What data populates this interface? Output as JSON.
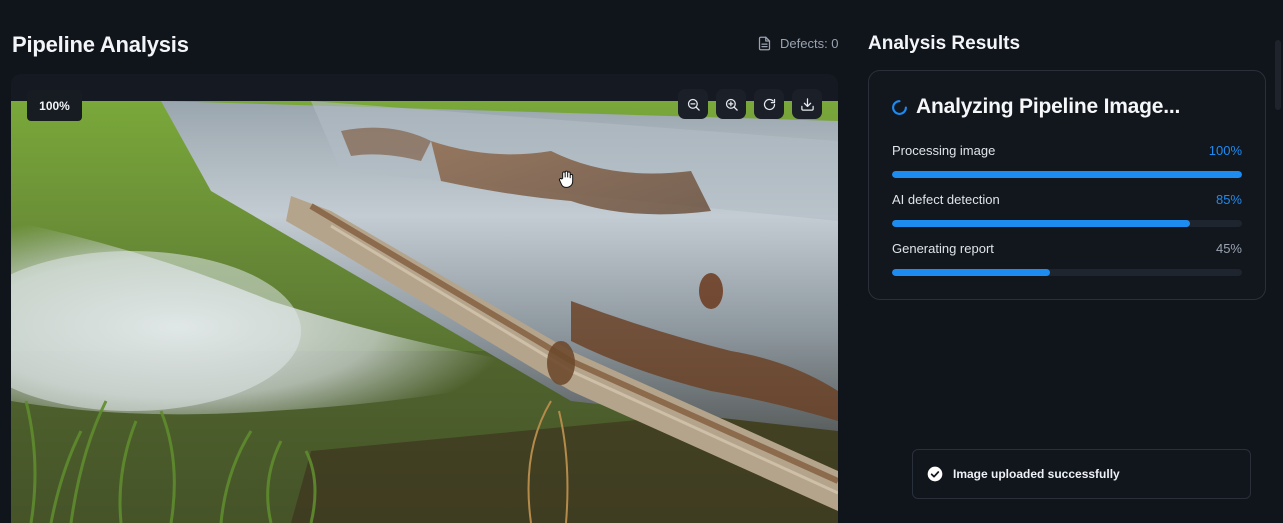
{
  "page": {
    "title": "Pipeline Analysis",
    "defects_label": "Defects: 0"
  },
  "viewer": {
    "zoom": "100%",
    "tools": [
      {
        "icon": "zoom-out-icon"
      },
      {
        "icon": "zoom-in-icon"
      },
      {
        "icon": "rotate-icon"
      },
      {
        "icon": "download-icon"
      }
    ]
  },
  "results": {
    "title": "Analysis Results",
    "heading": "Analyzing Pipeline Image...",
    "steps": [
      {
        "label": "Processing image",
        "pct": "100%",
        "value": 1.0,
        "color": "#1e8bf1"
      },
      {
        "label": "AI defect detection",
        "pct": "85%",
        "value": 0.85,
        "color": "#1e8bf1"
      },
      {
        "label": "Generating report",
        "pct": "45%",
        "value": 0.45,
        "color": "#9aa3b0"
      }
    ]
  },
  "toast": {
    "message": "Image uploaded successfully"
  },
  "colors": {
    "accent": "#1e8bf1",
    "background": "#10141b"
  }
}
